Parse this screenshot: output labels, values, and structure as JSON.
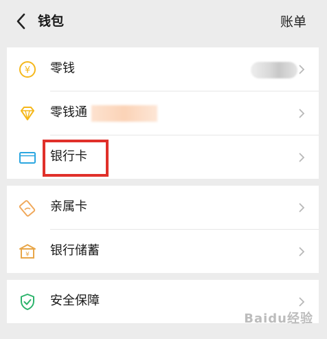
{
  "header": {
    "title": "钱包",
    "bill_label": "账单"
  },
  "sections": [
    {
      "items": [
        {
          "id": "change",
          "label": "零钱",
          "icon": "yuan-coin-icon"
        },
        {
          "id": "lingqiantong",
          "label": "零钱通",
          "icon": "diamond-icon"
        },
        {
          "id": "bank-card",
          "label": "银行卡",
          "icon": "bank-card-icon"
        }
      ]
    },
    {
      "items": [
        {
          "id": "family-card",
          "label": "亲属卡",
          "icon": "family-card-icon"
        },
        {
          "id": "bank-savings",
          "label": "银行储蓄",
          "icon": "bank-building-icon"
        }
      ]
    },
    {
      "items": [
        {
          "id": "security",
          "label": "安全保障",
          "icon": "shield-check-icon"
        }
      ]
    }
  ],
  "colors": {
    "accent_yellow": "#f5b71a",
    "card_blue": "#2aa6e0",
    "shield_green": "#2bb36b",
    "highlight_red": "#e0302a"
  },
  "watermark": "Baidu经验"
}
